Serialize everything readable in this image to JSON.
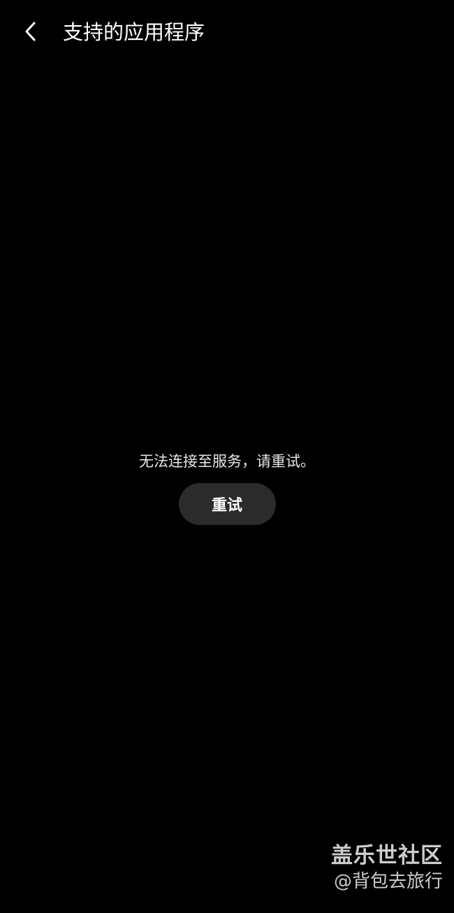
{
  "header": {
    "back_icon": "chevron-left-icon",
    "title": "支持的应用程序"
  },
  "error": {
    "message": "无法连接至服务，请重试。",
    "retry_label": "重试"
  },
  "watermark": {
    "line1": "盖乐世社区",
    "line2": "@背包去旅行"
  },
  "colors": {
    "background": "#000000",
    "text": "#ffffff",
    "button_bg": "#2b2b2b"
  }
}
